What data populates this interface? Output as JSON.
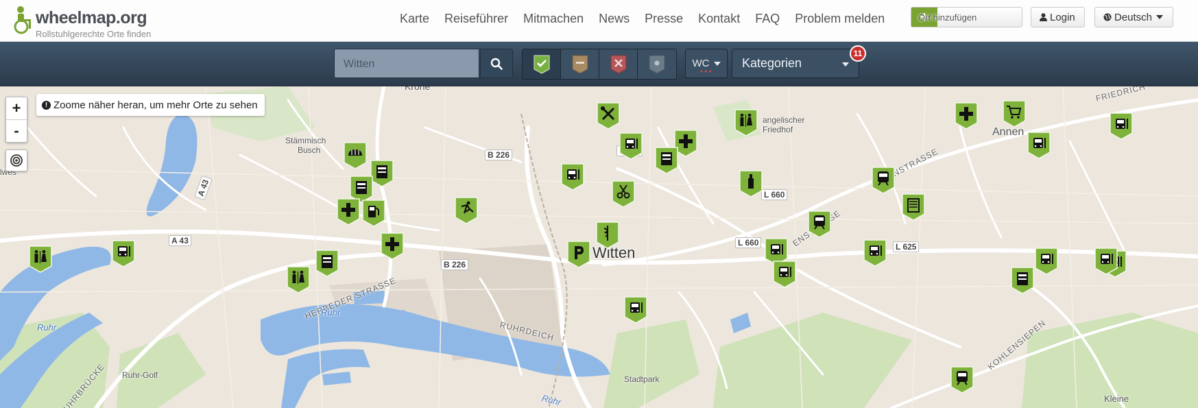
{
  "header": {
    "logo_text": "wheelmap.org",
    "tagline": "Rollstuhlgerechte Orte finden",
    "nav": [
      "Karte",
      "Reiseführer",
      "Mitmachen",
      "News",
      "Presse",
      "Kontakt",
      "FAQ",
      "Problem melden"
    ],
    "add_place_label": "Ort hinzufügen",
    "login_label": "Login",
    "language_label": "Deutsch"
  },
  "toolbar": {
    "search_value": "",
    "search_placeholder": "Witten",
    "filters": [
      "accessible",
      "limited",
      "not-accessible",
      "unknown"
    ],
    "wc_label": "WC",
    "categories_label": "Kategorien",
    "categories_badge": "11"
  },
  "map": {
    "hint": "Zoome näher heran, um mehr Orte zu sehen",
    "zoom_in": "+",
    "zoom_out": "-",
    "labels": {
      "city": "Witten",
      "district_annen": "Annen",
      "krone": "Krone",
      "staemmisch": "Stämmisch",
      "busch": "Busch",
      "friedhof_1": "angelischer",
      "friedhof_2": "Friedhof",
      "ruhr_golf": "Ruhr-Golf",
      "stadtpark": "Stadtpark",
      "kleine": "Kleine",
      "lwes": "lwes",
      "b226_a": "B 226",
      "b226_b": "B 226",
      "l525": "L 525",
      "l660_a": "L 660",
      "l660_b": "L 660",
      "l625": "L 625",
      "a43": "A 43",
      "a43_v": "A 43",
      "herbeder": "HERBEDER STRASSE",
      "ruhrdeich": "RUHRDEICH",
      "kohlensiepen": "KOHLENSIEPEN",
      "enstrasse": "ENSTRASSE",
      "friedrich": "FRIEDRICH",
      "ruhr_1": "Ruhr",
      "ruhr_2": "Ruhr",
      "ruhr_3": "Ruhr",
      "ruhrbruecke": "UHRBRÜCKE",
      "tr_a": "TR"
    },
    "markers": [
      {
        "icon": "bakery-icon"
      },
      {
        "icon": "tools-icon"
      },
      {
        "icon": "toilets-icon"
      },
      {
        "icon": "pharmacy-cross-icon"
      },
      {
        "icon": "shopping-cart-icon"
      },
      {
        "icon": "bus-stop-icon"
      },
      {
        "icon": "bus-stop-icon"
      },
      {
        "icon": "pharmacy-cross-icon"
      },
      {
        "icon": "atm-icon"
      },
      {
        "icon": "bus-stop-icon"
      },
      {
        "icon": "hairdresser-icon"
      },
      {
        "icon": "atm-icon"
      },
      {
        "icon": "atm-icon"
      },
      {
        "icon": "bar-icon"
      },
      {
        "icon": "train-icon"
      },
      {
        "icon": "vending-icon"
      },
      {
        "icon": "sports-icon"
      },
      {
        "icon": "fuel-icon"
      },
      {
        "icon": "pharmacy-cross-icon"
      },
      {
        "icon": "pharmacy-cross-icon"
      },
      {
        "icon": "bus-stop-icon"
      },
      {
        "icon": "train-icon"
      },
      {
        "icon": "medical-icon"
      },
      {
        "icon": "parking-icon"
      },
      {
        "icon": "toilets-icon"
      },
      {
        "icon": "atm-icon"
      },
      {
        "icon": "toilets-icon"
      },
      {
        "icon": "bus-stop-icon"
      },
      {
        "icon": "bus-stop-icon"
      },
      {
        "icon": "bus-stop-icon"
      },
      {
        "icon": "bus-stop-icon"
      },
      {
        "icon": "bus-stop-icon"
      },
      {
        "icon": "atm-icon"
      },
      {
        "icon": "bus-stop-icon"
      },
      {
        "icon": "bus-stop-icon"
      },
      {
        "icon": "bus-stop-icon"
      },
      {
        "icon": "train-icon"
      }
    ]
  },
  "colors": {
    "marker_green": "#7fb23a",
    "toolbar_dark": "#2f4253",
    "water": "#8fb8e6",
    "park": "#c9dfae"
  }
}
